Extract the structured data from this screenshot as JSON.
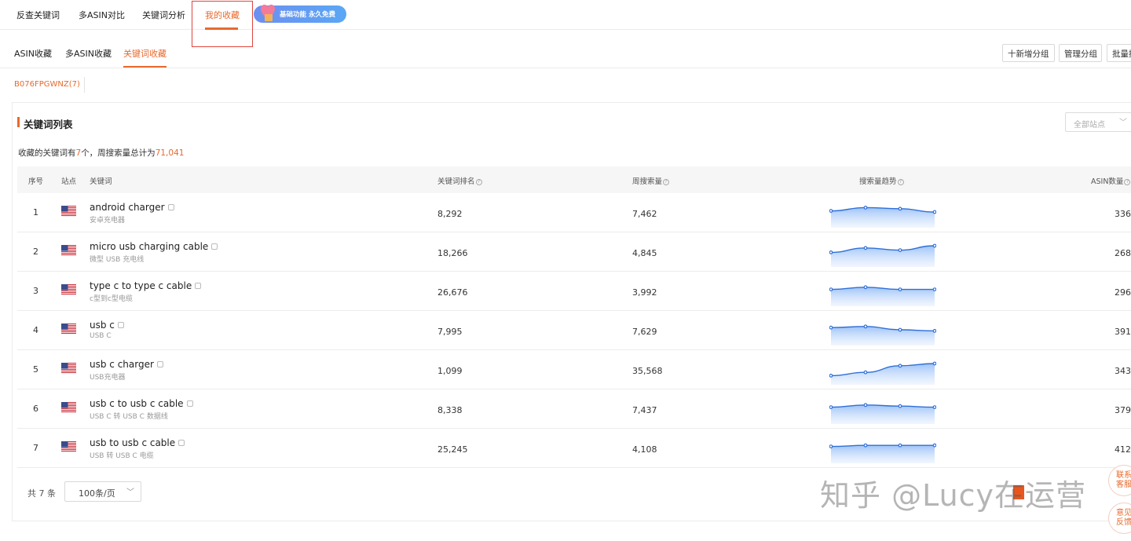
{
  "topnav": {
    "items": [
      "反查关键词",
      "多ASIN对比",
      "关键词分析",
      "我的收藏"
    ],
    "promo": "基础功能 永久免费"
  },
  "subtabs": {
    "items": [
      "ASIN收藏",
      "多ASIN收藏",
      "关键词收藏"
    ],
    "buttons": [
      "十新增分组",
      "管理分组",
      "批量操"
    ]
  },
  "asin_group": "B076FPGWNZ(7)",
  "card": {
    "title": "关键词列表",
    "site_select": "全部站点",
    "summary": {
      "prefix": "收藏的关键词有",
      "count": "7",
      "middle": "个，周搜索量总计为",
      "total": "71,041"
    }
  },
  "table": {
    "headers": {
      "idx": "序号",
      "site": "站点",
      "keyword": "关键词",
      "rank": "关键词排名",
      "volume": "周搜索量",
      "trend": "搜索量趋势",
      "asin": "ASIN数量"
    },
    "rows": [
      {
        "idx": "1",
        "keyword": "android charger",
        "keyword_cn": "安卓充电器",
        "rank": "8,292",
        "volume": "7,462",
        "asin": "336",
        "trend": [
          0.55,
          0.7,
          0.65,
          0.5
        ]
      },
      {
        "idx": "2",
        "keyword": "micro usb charging cable",
        "keyword_cn": "微型 USB 充电线",
        "rank": "18,266",
        "volume": "4,845",
        "asin": "268",
        "trend": [
          0.45,
          0.65,
          0.55,
          0.75
        ]
      },
      {
        "idx": "3",
        "keyword": "type c to type c cable",
        "keyword_cn": "c型到c型电缆",
        "rank": "26,676",
        "volume": "3,992",
        "asin": "296",
        "trend": [
          0.55,
          0.65,
          0.55,
          0.55
        ]
      },
      {
        "idx": "4",
        "keyword": "usb c",
        "keyword_cn": "USB C",
        "rank": "7,995",
        "volume": "7,629",
        "asin": "391",
        "trend": [
          0.6,
          0.65,
          0.5,
          0.45
        ]
      },
      {
        "idx": "5",
        "keyword": "usb c charger",
        "keyword_cn": "USB充电器",
        "rank": "1,099",
        "volume": "35,568",
        "asin": "343",
        "trend": [
          0.2,
          0.35,
          0.65,
          0.75
        ]
      },
      {
        "idx": "6",
        "keyword": "usb c to usb c cable",
        "keyword_cn": "USB C 转 USB C 数据线",
        "rank": "8,338",
        "volume": "7,437",
        "asin": "379",
        "trend": [
          0.55,
          0.65,
          0.6,
          0.55
        ]
      },
      {
        "idx": "7",
        "keyword": "usb to usb c cable",
        "keyword_cn": "USB 转 USB C 电缆",
        "rank": "25,245",
        "volume": "4,108",
        "asin": "412",
        "trend": [
          0.55,
          0.6,
          0.6,
          0.6
        ]
      }
    ]
  },
  "pager": {
    "total": "共 7 条",
    "page_size": "100条/页"
  },
  "watermark": "知乎 @Lucy在运营",
  "side_buttons": [
    "联系客服",
    "意见反馈"
  ],
  "colors": {
    "accent": "#e8692d",
    "trend_line": "#2f6fd8"
  }
}
